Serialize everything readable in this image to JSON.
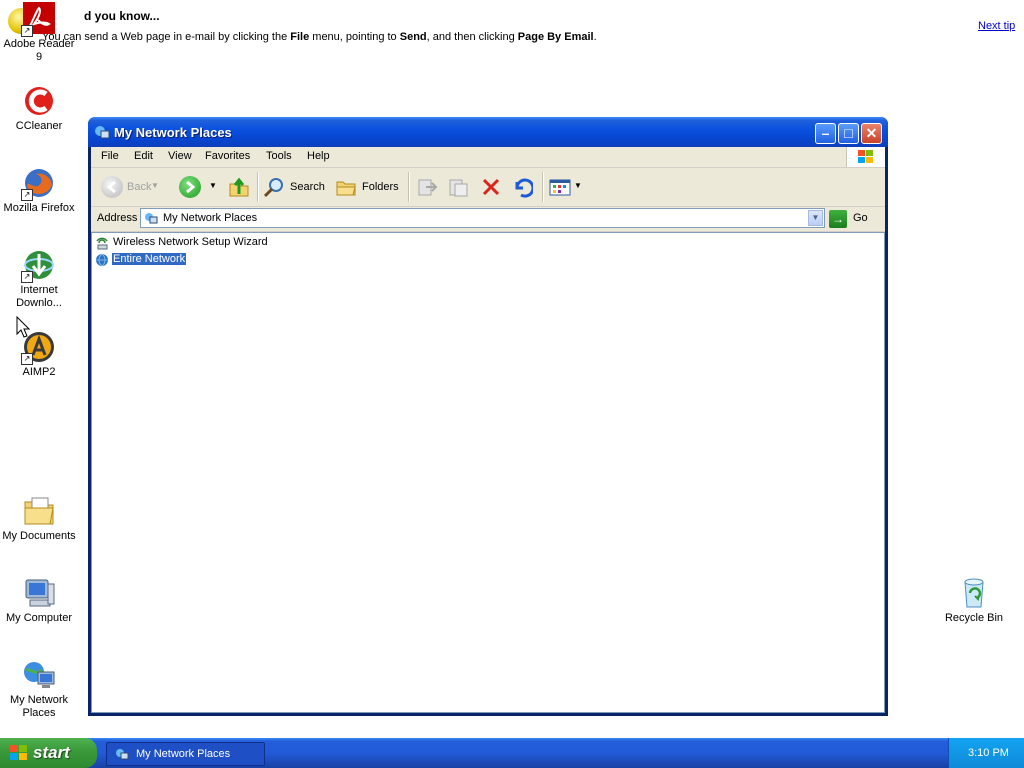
{
  "tip": {
    "title": "d you know...",
    "body_prefix": "You can send a Web page in e-mail by clicking the ",
    "bold1": "File",
    "body_mid1": " menu, pointing to ",
    "bold2": "Send",
    "body_mid2": ", and then clicking ",
    "bold3": "Page By Email",
    "body_suffix": ".",
    "next_link": "Next tip"
  },
  "desktop": {
    "icons": [
      {
        "label": "Adobe Reader 9"
      },
      {
        "label": "CCleaner"
      },
      {
        "label": "Mozilla Firefox"
      },
      {
        "label": "Internet Downlo..."
      },
      {
        "label": "AIMP2"
      },
      {
        "label": "My Documents"
      },
      {
        "label": "My Computer"
      },
      {
        "label": "My Network Places"
      },
      {
        "label": "Recycle Bin"
      }
    ]
  },
  "window": {
    "title": "My Network Places",
    "menu": [
      "File",
      "Edit",
      "View",
      "Favorites",
      "Tools",
      "Help"
    ],
    "toolbar": {
      "back": "Back",
      "search": "Search",
      "folders": "Folders"
    },
    "address": {
      "label": "Address",
      "value": "My Network Places",
      "go": "Go"
    },
    "items": [
      {
        "label": "Wireless Network Setup Wizard",
        "selected": false
      },
      {
        "label": "Entire Network",
        "selected": true
      }
    ]
  },
  "taskbar": {
    "start": "start",
    "task": "My Network Places",
    "clock": "3:10 PM"
  }
}
